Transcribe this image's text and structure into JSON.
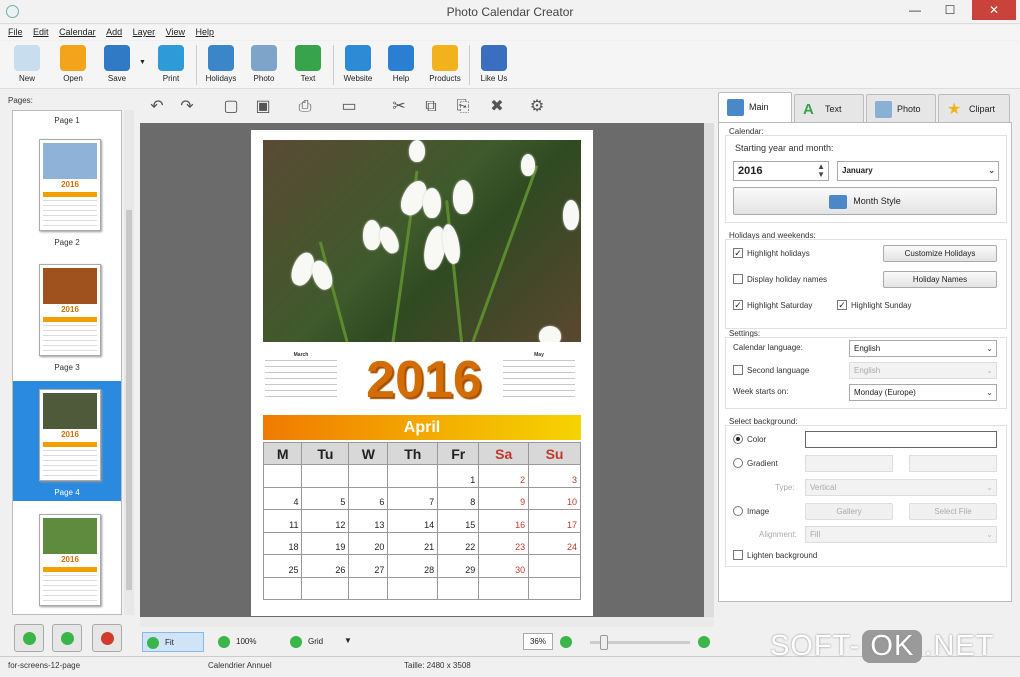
{
  "window": {
    "title": "Photo Calendar Creator",
    "min": "—",
    "max": "☐",
    "close": "✕"
  },
  "menu": [
    "File",
    "Edit",
    "Calendar",
    "Add",
    "Layer",
    "View",
    "Help"
  ],
  "toolbar": [
    {
      "label": "New",
      "color": "#c8ddee"
    },
    {
      "label": "Open",
      "color": "#f3a41a"
    },
    {
      "label": "Save",
      "color": "#2f79c5"
    },
    {
      "label": "Print",
      "color": "#2f9ad8"
    },
    {
      "label": "Holidays",
      "color": "#3b86c9"
    },
    {
      "label": "Photo",
      "color": "#7fa4c9"
    },
    {
      "label": "Text",
      "color": "#37a34a"
    },
    {
      "label": "Website",
      "color": "#2d8bd6"
    },
    {
      "label": "Help",
      "color": "#2b7fd2"
    },
    {
      "label": "Products",
      "color": "#f2b21d"
    },
    {
      "label": "Like Us",
      "color": "#3a6fc0"
    }
  ],
  "pages": {
    "header": "Pages:",
    "items": [
      {
        "caption": "Page 1",
        "year": "2016",
        "img": "#8fb3d8"
      },
      {
        "caption": "Page 2",
        "year": "2016",
        "img": "#a0521e"
      },
      {
        "caption": "Page 3",
        "year": "2016",
        "img": "#4e5a3a"
      },
      {
        "caption": "Page 4",
        "year": "2016",
        "img": "#5e8b3e",
        "selected": true
      }
    ]
  },
  "edit_tools": [
    "↶",
    "↷",
    "▢",
    "▣",
    "⎙",
    "▭",
    "✂",
    "⧉",
    "⎘",
    "✖",
    "⚙"
  ],
  "calendar": {
    "year": "2016",
    "month": "April",
    "prev_month": "March",
    "next_month": "May",
    "weekdays": [
      "M",
      "Tu",
      "W",
      "Th",
      "Fr",
      "Sa",
      "Su"
    ],
    "weeks": [
      [
        "",
        "",
        "",
        "",
        "1",
        "2",
        "3"
      ],
      [
        "4",
        "5",
        "6",
        "7",
        "8",
        "9",
        "10"
      ],
      [
        "11",
        "12",
        "13",
        "14",
        "15",
        "16",
        "17"
      ],
      [
        "18",
        "19",
        "20",
        "21",
        "22",
        "23",
        "24"
      ],
      [
        "25",
        "26",
        "27",
        "28",
        "29",
        "30",
        ""
      ],
      [
        "",
        "",
        "",
        "",
        "",
        "",
        ""
      ]
    ]
  },
  "right": {
    "tabs": [
      {
        "label": "Main",
        "icon": "calendar-icon"
      },
      {
        "label": "Text",
        "icon": "text-icon"
      },
      {
        "label": "Photo",
        "icon": "photo-icon"
      },
      {
        "label": "Clipart",
        "icon": "star-icon"
      }
    ],
    "calendar_group": "Calendar:",
    "start_label": "Starting year and month:",
    "year_value": "2016",
    "month_value": "January",
    "month_style": "Month Style",
    "holidays_group": "Holidays and weekends:",
    "highlight_holidays": "Highlight holidays",
    "customize_holidays": "Customize Holidays",
    "display_holiday_names": "Display holiday names",
    "holiday_names": "Holiday Names",
    "highlight_saturday": "Highlight Saturday",
    "highlight_sunday": "Highlight Sunday",
    "settings_group": "Settings:",
    "calendar_language": "Calendar language:",
    "calendar_language_value": "English",
    "second_language": "Second language",
    "second_language_value": "English",
    "week_starts": "Week starts on:",
    "week_starts_value": "Monday (Europe)",
    "bg_group": "Select background:",
    "color": "Color",
    "gradient": "Gradient",
    "type": "Type:",
    "type_value": "Vertical",
    "image": "Image",
    "gallery": "Gallery",
    "select_file": "Select File",
    "alignment": "Alignment:",
    "alignment_value": "Fill",
    "lighten": "Lighten background"
  },
  "bottom": {
    "fit": "Fit",
    "zoom100": "100%",
    "grid": "Grid",
    "zoom_value": "36%"
  },
  "status": {
    "left": "for-screens-12-page",
    "middle": "Calendrier Annuel",
    "size": "Taille: 2480 x 3508"
  },
  "watermark": {
    "a": "SOFT-",
    "b": "OK",
    "c": ".NET"
  }
}
